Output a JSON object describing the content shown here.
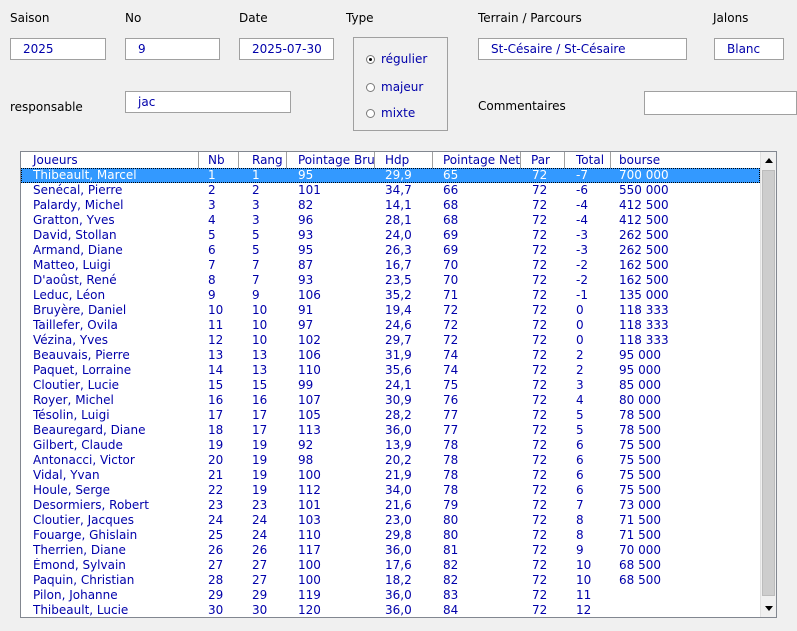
{
  "form": {
    "saison_label": "Saison",
    "saison_value": "2025",
    "no_label": "No",
    "no_value": "9",
    "date_label": "Date",
    "date_value": "2025-07-30",
    "type_label": "Type",
    "type_options": [
      "régulier",
      "majeur",
      "mixte"
    ],
    "type_selected": "régulier",
    "terrain_label": "Terrain / Parcours",
    "terrain_value": "St-Césaire / St-Césaire",
    "jalons_label": "Jalons",
    "jalons_value": "Blanc",
    "responsable_label": "responsable",
    "responsable_value": "jac",
    "commentaires_label": "Commentaires",
    "commentaires_value": ""
  },
  "table": {
    "headers": [
      "Joueurs",
      "Nb",
      "Rang",
      "Pointage Brut",
      "Hdp",
      "Pointage Net",
      "Par",
      "Total",
      "bourse"
    ],
    "selected_index": 0,
    "rows": [
      [
        "Thibeault, Marcel",
        "1",
        "1",
        "95",
        "29,9",
        "65",
        "72",
        "-7",
        "700 000"
      ],
      [
        "Senécal, Pierre",
        "2",
        "2",
        "101",
        "34,7",
        "66",
        "72",
        "-6",
        "550 000"
      ],
      [
        "Palardy, Michel",
        "3",
        "3",
        "82",
        "14,1",
        "68",
        "72",
        "-4",
        "412 500"
      ],
      [
        "Gratton, Yves",
        "4",
        "3",
        "96",
        "28,1",
        "68",
        "72",
        "-4",
        "412 500"
      ],
      [
        "David, Stollan",
        "5",
        "5",
        "93",
        "24,0",
        "69",
        "72",
        "-3",
        "262 500"
      ],
      [
        "Armand, Diane",
        "6",
        "5",
        "95",
        "26,3",
        "69",
        "72",
        "-3",
        "262 500"
      ],
      [
        "Matteo, Luigi",
        "7",
        "7",
        "87",
        "16,7",
        "70",
        "72",
        "-2",
        "162 500"
      ],
      [
        "D'aoûst, René",
        "8",
        "7",
        "93",
        "23,5",
        "70",
        "72",
        "-2",
        "162 500"
      ],
      [
        "Leduc, Léon",
        "9",
        "9",
        "106",
        "35,2",
        "71",
        "72",
        "-1",
        "135 000"
      ],
      [
        "Bruyère, Daniel",
        "10",
        "10",
        "91",
        "19,4",
        "72",
        "72",
        "0",
        "118 333"
      ],
      [
        "Taillefer, Ovila",
        "11",
        "10",
        "97",
        "24,6",
        "72",
        "72",
        "0",
        "118 333"
      ],
      [
        "Vézina, Yves",
        "12",
        "10",
        "102",
        "29,7",
        "72",
        "72",
        "0",
        "118 333"
      ],
      [
        "Beauvais, Pierre",
        "13",
        "13",
        "106",
        "31,9",
        "74",
        "72",
        "2",
        "95 000"
      ],
      [
        "Paquet, Lorraine",
        "14",
        "13",
        "110",
        "35,6",
        "74",
        "72",
        "2",
        "95 000"
      ],
      [
        "Cloutier, Lucie",
        "15",
        "15",
        "99",
        "24,1",
        "75",
        "72",
        "3",
        "85 000"
      ],
      [
        "Royer, Michel",
        "16",
        "16",
        "107",
        "30,9",
        "76",
        "72",
        "4",
        "80 000"
      ],
      [
        "Tésolin, Luigi",
        "17",
        "17",
        "105",
        "28,2",
        "77",
        "72",
        "5",
        "78 500"
      ],
      [
        "Beauregard, Diane",
        "18",
        "17",
        "113",
        "36,0",
        "77",
        "72",
        "5",
        "78 500"
      ],
      [
        "Gilbert, Claude",
        "19",
        "19",
        "92",
        "13,9",
        "78",
        "72",
        "6",
        "75 500"
      ],
      [
        "Antonacci, Victor",
        "20",
        "19",
        "98",
        "20,2",
        "78",
        "72",
        "6",
        "75 500"
      ],
      [
        "Vidal, Yvan",
        "21",
        "19",
        "100",
        "21,9",
        "78",
        "72",
        "6",
        "75 500"
      ],
      [
        "Houle, Serge",
        "22",
        "19",
        "112",
        "34,0",
        "78",
        "72",
        "6",
        "75 500"
      ],
      [
        "Desormiers, Robert",
        "23",
        "23",
        "101",
        "21,6",
        "79",
        "72",
        "7",
        "73 000"
      ],
      [
        "Cloutier, Jacques",
        "24",
        "24",
        "103",
        "23,0",
        "80",
        "72",
        "8",
        "71 500"
      ],
      [
        "Fouarge, Ghislain",
        "25",
        "24",
        "110",
        "29,8",
        "80",
        "72",
        "8",
        "71 500"
      ],
      [
        "Therrien, Diane",
        "26",
        "26",
        "117",
        "36,0",
        "81",
        "72",
        "9",
        "70 000"
      ],
      [
        "Émond, Sylvain",
        "27",
        "27",
        "100",
        "17,6",
        "82",
        "72",
        "10",
        "68 500"
      ],
      [
        "Paquin, Christian",
        "28",
        "27",
        "100",
        "18,2",
        "82",
        "72",
        "10",
        "68 500"
      ],
      [
        "Pilon, Johanne",
        "29",
        "29",
        "119",
        "36,0",
        "83",
        "72",
        "11",
        ""
      ],
      [
        "Thibeault, Lucie",
        "30",
        "30",
        "120",
        "36,0",
        "84",
        "72",
        "12",
        ""
      ]
    ]
  },
  "icons": {
    "scroll_up": "scroll-up-arrow-icon",
    "scroll_down": "scroll-down-arrow-icon"
  },
  "colors": {
    "value_text": "#0000aa",
    "selection": "#3399ff",
    "background": "#f0f0f0"
  }
}
